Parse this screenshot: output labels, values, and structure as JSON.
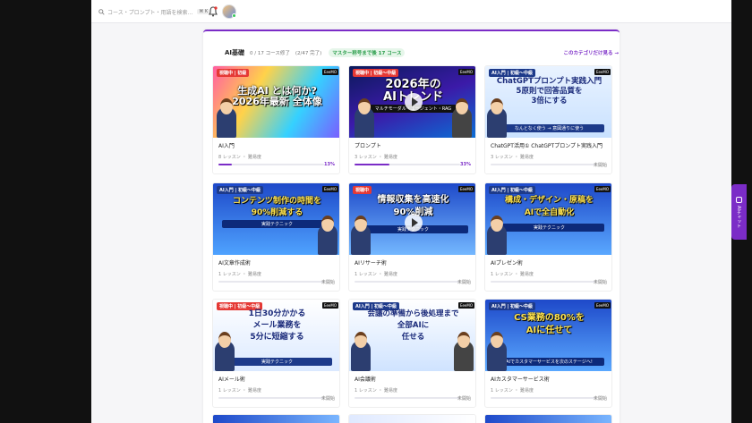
{
  "search": {
    "placeholder": "コース・プロンプト・用語を検索...",
    "shortcut": "⌘ K"
  },
  "section": {
    "title": "AI基礎",
    "count": "0 / 17 コース修了",
    "done": "(2/47 完了)",
    "badge": "マスター称号まで後 17 コース",
    "link": "このカテゴリだけ見る →"
  },
  "side_tab": {
    "label": "AIチャット"
  },
  "cards": [
    {
      "title": "AI入門",
      "meta": "8 レッスン ・ 難易度",
      "status": "13%",
      "progress": 13,
      "tag": "視聴中 | 初級",
      "logo": "EeeMO",
      "headline": "生成AI とは何か?\n2026年最新 全体像",
      "subline": ""
    },
    {
      "title": "プロンプト",
      "meta": "3 レッスン ・ 難易度",
      "status": "33%",
      "progress": 33,
      "tag": "視聴中 | 初級〜中級",
      "logo": "EeeMO",
      "headline": "2026年の\nAIトレンド",
      "subline": "マルチモーダル・エージェント・RAG"
    },
    {
      "title": "ChatGPT活用① ChatGPTプロンプト実践入門",
      "meta": "3 レッスン ・ 難易度",
      "status": "未開始",
      "progress": 0,
      "tag": "AI入門 | 初級〜中級",
      "logo": "EeeMO",
      "headline": "ChatGPTプロンプト実践入門\n5原則で回答品質を\n3倍にする",
      "subline": "なんとなく使う → 意図通りに使う"
    },
    {
      "title": "AI文章作成術",
      "meta": "1 レッスン ・ 難易度",
      "status": "未開始",
      "progress": 0,
      "tag": "AI入門 | 初級〜中級",
      "logo": "EeeMO",
      "headline": "コンテンツ制作の時間を\n90%削減する",
      "subline": "実践テクニック"
    },
    {
      "title": "AIリサーチ術",
      "meta": "1 レッスン ・ 難易度",
      "status": "未開始",
      "progress": 0,
      "tag": "視聴中",
      "logo": "EeeMO",
      "headline": "情報収集を高速化\n90%削減",
      "subline": "実践テクニック"
    },
    {
      "title": "AIプレゼン術",
      "meta": "1 レッスン ・ 難易度",
      "status": "未開始",
      "progress": 0,
      "tag": "AI入門 | 初級〜中級",
      "logo": "EeeMO",
      "headline": "構成・デザイン・原稿を\nAIで全自動化",
      "subline": "実践テクニック"
    },
    {
      "title": "AIメール術",
      "meta": "1 レッスン ・ 難易度",
      "status": "未開始",
      "progress": 0,
      "tag": "視聴中 | 初級〜中級",
      "logo": "EeeMO",
      "headline": "1日30分かかる\nメール業務を\n5分に短縮する",
      "subline": "実践テクニック"
    },
    {
      "title": "AI会議術",
      "meta": "1 レッスン ・ 難易度",
      "status": "未開始",
      "progress": 0,
      "tag": "AI入門 | 初級〜中級",
      "logo": "EeeMO",
      "headline": "会議の準備から後処理まで\n全部AIに\n任せる",
      "subline": ""
    },
    {
      "title": "AIカスタマーサービス術",
      "meta": "1 レッスン ・ 難易度",
      "status": "未開始",
      "progress": 0,
      "tag": "AI入門 | 初級〜中級",
      "logo": "EeeMO",
      "headline": "CS業務の80%を\nAIに任せて",
      "subline": "AIでカスタマーサービスを次のステージへ!"
    }
  ],
  "colors": {
    "accent": "#7b2cc7",
    "badge_green": "#2a9d4b"
  }
}
